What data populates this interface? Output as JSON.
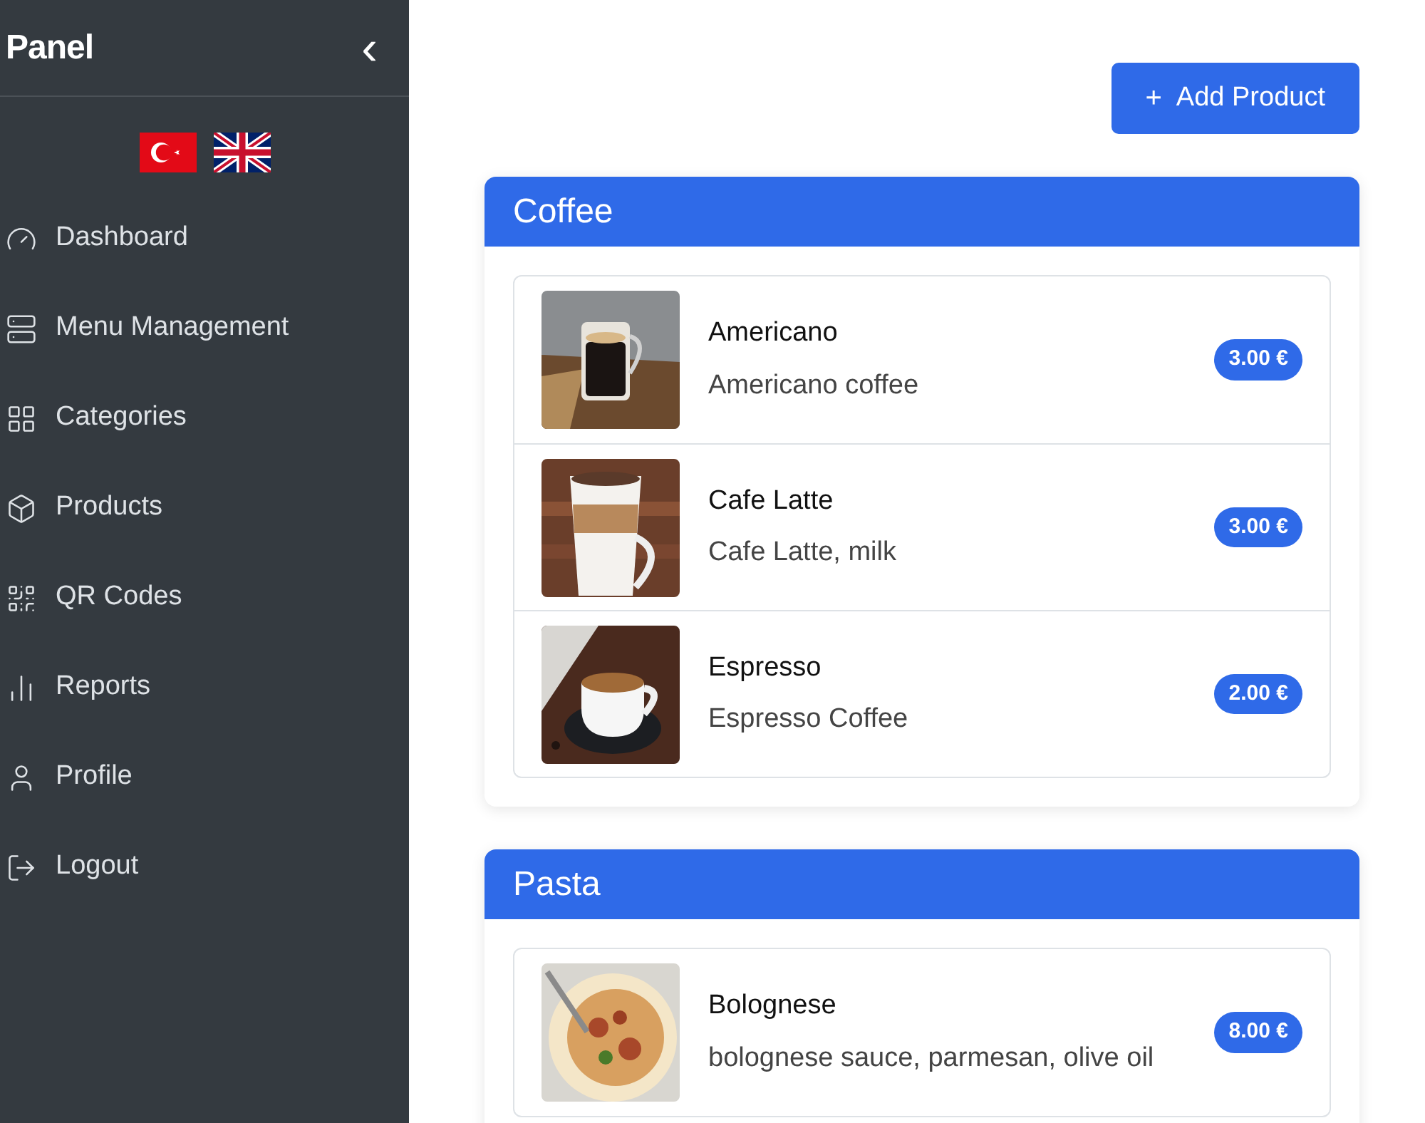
{
  "sidebar": {
    "title": "Panel",
    "collapse_icon": "‹",
    "languages": [
      {
        "kind": "tr"
      },
      {
        "kind": "en"
      }
    ],
    "items": [
      {
        "label": "Dashboard",
        "kind": "gauge"
      },
      {
        "label": "Menu Management",
        "kind": "menu"
      },
      {
        "label": "Categories",
        "kind": "grid"
      },
      {
        "label": "Products",
        "kind": "box"
      },
      {
        "label": "QR Codes",
        "kind": "qr"
      },
      {
        "label": "Reports",
        "kind": "chart"
      },
      {
        "label": "Profile",
        "kind": "user"
      },
      {
        "label": "Logout",
        "kind": "logout"
      }
    ]
  },
  "add_button": {
    "icon": "+",
    "label": "Add Product"
  },
  "categories": [
    {
      "title": "Coffee",
      "products": [
        {
          "name": "Americano",
          "description": "Americano coffee",
          "price": "3.00 €",
          "kind": "glass"
        },
        {
          "name": "Cafe Latte",
          "description": "Cafe Latte, milk",
          "price": "3.00 €",
          "kind": "latte"
        },
        {
          "name": "Espresso",
          "description": "Espresso Coffee",
          "price": "2.00 €",
          "kind": "cup"
        }
      ]
    },
    {
      "title": "Pasta",
      "products": [
        {
          "name": "Bolognese",
          "description": "bolognese sauce, parmesan, olive oil",
          "price": "8.00 €",
          "kind": "pasta"
        }
      ]
    }
  ]
}
